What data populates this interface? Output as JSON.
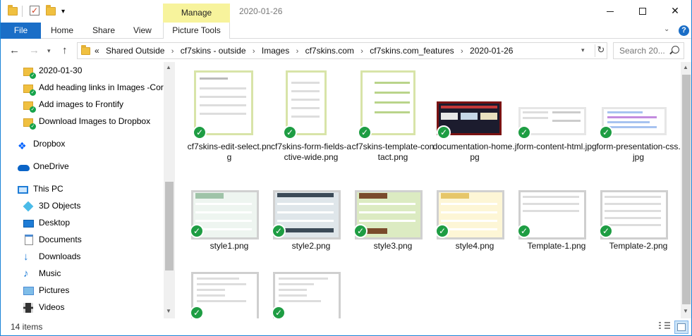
{
  "window": {
    "title": "2020-01-26",
    "manage_label": "Manage",
    "controls": {
      "minimize": "minimize",
      "maximize": "maximize",
      "close": "✕"
    }
  },
  "ribbon": {
    "tabs": [
      {
        "label": "File"
      },
      {
        "label": "Home"
      },
      {
        "label": "Share"
      },
      {
        "label": "View"
      },
      {
        "label": "Picture Tools"
      }
    ],
    "expand_chevron": "⌄",
    "help": "?"
  },
  "address_bar": {
    "overflow": "«",
    "crumbs": [
      "Shared Outside",
      "cf7skins - outside",
      "Images",
      "cf7skins.com",
      "cf7skins.com_features",
      "2020-01-26"
    ],
    "separator": "›"
  },
  "search": {
    "placeholder": "Search 20..."
  },
  "nav_pane": {
    "items": [
      {
        "label": "2020-01-30",
        "icon": "synced-folder-icon"
      },
      {
        "label": "Add heading links in Images -Cor",
        "icon": "synced-folder-icon"
      },
      {
        "label": "Add images to Frontify",
        "icon": "synced-folder-icon"
      },
      {
        "label": "Download Images to Dropbox",
        "icon": "synced-folder-icon"
      },
      {
        "label": "Dropbox",
        "icon": "dropbox-icon"
      },
      {
        "label": "OneDrive",
        "icon": "onedrive-icon"
      },
      {
        "label": "This PC",
        "icon": "this-pc-icon"
      },
      {
        "label": "3D Objects",
        "icon": "3d-objects-icon"
      },
      {
        "label": "Desktop",
        "icon": "desktop-icon"
      },
      {
        "label": "Documents",
        "icon": "documents-icon"
      },
      {
        "label": "Downloads",
        "icon": "downloads-icon"
      },
      {
        "label": "Music",
        "icon": "music-icon"
      },
      {
        "label": "Pictures",
        "icon": "pictures-icon"
      },
      {
        "label": "Videos",
        "icon": "videos-icon"
      }
    ]
  },
  "files": [
    {
      "name": "cf7skins-edit-select.png"
    },
    {
      "name": "cf7skins-form-fields-active-wide.png"
    },
    {
      "name": "cf7skins-template-contact.png"
    },
    {
      "name": "documentation-home.jpg"
    },
    {
      "name": "form-content-html.jpg"
    },
    {
      "name": "form-presentation-css.jpg"
    },
    {
      "name": "style1.png"
    },
    {
      "name": "style2.png"
    },
    {
      "name": "style3.png"
    },
    {
      "name": "style4.png"
    },
    {
      "name": "Template-1.png"
    },
    {
      "name": "Template-2.png"
    },
    {
      "name": ""
    },
    {
      "name": ""
    }
  ],
  "status": {
    "item_count": "14 items"
  },
  "colors": {
    "accent": "#1a6ec7",
    "manage_tab": "#f7f39c",
    "sync_badge": "#1e9d43",
    "folder": "#f0c040"
  }
}
